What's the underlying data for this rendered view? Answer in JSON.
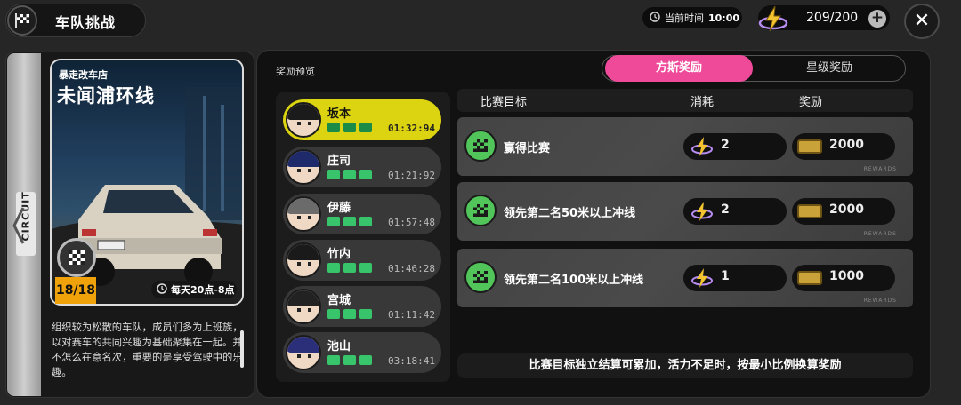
{
  "header": {
    "title": "车队挑战",
    "time_label": "当前时间",
    "time_value": "10:00",
    "energy": "209/200",
    "add_symbol": "+",
    "close_symbol": "✕"
  },
  "card": {
    "circuit_label": "CIRCUIT",
    "subtitle": "暴走改车店",
    "title": "未闻浦环线",
    "count": "18/18",
    "schedule": "每天20点-8点",
    "description": "组织较为松散的车队，成员们多为上班族，以对赛车的共同兴趣为基础聚集在一起。并不怎么在意名次，重要的是享受驾驶中的乐趣。"
  },
  "panel": {
    "reward_preview": "奖励预览",
    "tabs": [
      {
        "label": "方斯奖励",
        "active": true
      },
      {
        "label": "星级奖励",
        "active": false
      }
    ],
    "drivers": [
      {
        "name": "坂本",
        "time": "01:32:94",
        "active": true,
        "hair": "#1b1b1b"
      },
      {
        "name": "庄司",
        "time": "01:21:92",
        "active": false,
        "hair": "#1f2a6b"
      },
      {
        "name": "伊藤",
        "time": "01:57:48",
        "active": false,
        "hair": "#6b6b6b"
      },
      {
        "name": "竹内",
        "time": "01:46:28",
        "active": false,
        "hair": "#1a1a1a"
      },
      {
        "name": "宫城",
        "time": "01:11:42",
        "active": false,
        "hair": "#222222"
      },
      {
        "name": "池山",
        "time": "03:18:41",
        "active": false,
        "hair": "#2b2f7a"
      }
    ],
    "table_headers": {
      "goal": "比赛目标",
      "cost": "消耗",
      "reward": "奖励"
    },
    "objectives": [
      {
        "name": "赢得比赛",
        "cost": "2",
        "reward": "2000",
        "tag": "REWARDS"
      },
      {
        "name": "领先第二名50米以上冲线",
        "cost": "2",
        "reward": "2000",
        "tag": "REWARDS"
      },
      {
        "name": "领先第二名100米以上冲线",
        "cost": "1",
        "reward": "1000",
        "tag": "REWARDS"
      }
    ],
    "footer_note": "比赛目标独立结算可累加，活力不足时，按最小比例换算奖励"
  },
  "colors": {
    "accent_pink": "#ef4a9a",
    "active_driver": "#dcd410",
    "flag_green": "#37c46a",
    "count_badge": "#f0a20a"
  },
  "icons": {
    "header": "checkered-flag-icon",
    "close": "close-icon",
    "energy": "lightning-energy-icon",
    "clock": "clock-icon",
    "objective": "checkered-flag-icon",
    "reward": "ticket-icon"
  }
}
